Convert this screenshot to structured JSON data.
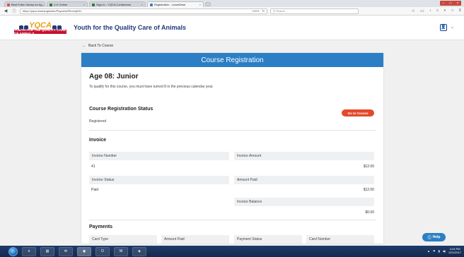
{
  "browser": {
    "tabs": [
      {
        "label": "Best Folks Library for Ag...",
        "active": false
      },
      {
        "label": "4-H Online",
        "active": false
      },
      {
        "label": "Sign-In - YQCA Conference",
        "active": false
      },
      {
        "label": "Registration - LearnDesk",
        "active": true
      }
    ],
    "url": "https://yqca.learningstudio/Payment/Receipt/41",
    "zoom": "100%",
    "search_placeholder": "Search"
  },
  "site": {
    "logo_text": "YQCA",
    "logo_tagline": "YOUTH FOR THE QUALITY CARE OF ANIMALS",
    "title": "Youth for the Quality Care of Animals"
  },
  "back_link": "Back To Course",
  "card": {
    "header": "Course Registration",
    "level_title": "Age 08: Junior",
    "level_desc": "To qualify for this course, you must have turned 8 in the previous calendar year.",
    "reg_status": {
      "title": "Course Registration Status",
      "value": "Registered",
      "go_button": "Go to Course"
    },
    "invoice": {
      "title": "Invoice",
      "number_label": "Invoice Number",
      "number_value": "41",
      "amount_label": "Invoice Amount",
      "amount_value": "$12.00",
      "status_label": "Invoice Status",
      "status_value": "Paid",
      "paid_label": "Amount Paid",
      "paid_value": "$12.00",
      "balance_label": "Invoice Balance",
      "balance_value": "$0.00"
    },
    "payments": {
      "title": "Payments",
      "columns": [
        "Card Type",
        "Amount Paid",
        "Payment Status",
        "Card Number"
      ]
    }
  },
  "help_button": "Help",
  "taskbar": {
    "time": "4:24 PM",
    "date": "2/21/2017"
  }
}
